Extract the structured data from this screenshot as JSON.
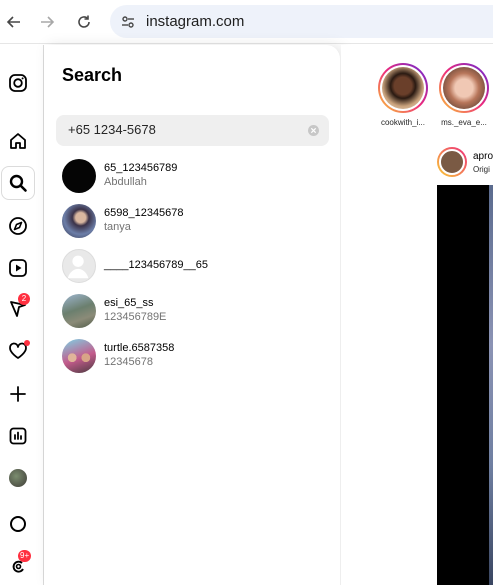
{
  "browser": {
    "url": "instagram.com",
    "back_icon": "arrow-left-icon",
    "forward_icon": "arrow-right-icon",
    "reload_icon": "reload-icon",
    "site_info_icon": "tune-icon"
  },
  "sidebar": {
    "items": [
      {
        "name": "instagram-logo-icon"
      },
      {
        "name": "home-icon"
      },
      {
        "name": "search-icon"
      },
      {
        "name": "explore-icon"
      },
      {
        "name": "reels-icon"
      },
      {
        "name": "messages-icon",
        "badge": "2"
      },
      {
        "name": "notifications-icon"
      },
      {
        "name": "create-icon"
      },
      {
        "name": "dashboard-icon"
      },
      {
        "name": "profile-avatar"
      },
      {
        "name": "threads-icon"
      },
      {
        "name": "more-icon",
        "badge": "9+"
      }
    ]
  },
  "search": {
    "title": "Search",
    "query": "+65 1234-5678",
    "results": [
      {
        "username": "65_123456789",
        "subtitle": "Abdullah"
      },
      {
        "username": "6598_12345678",
        "subtitle": "tanya"
      },
      {
        "username": "____123456789__65",
        "subtitle": ""
      },
      {
        "username": "esi_65_ss",
        "subtitle": "123456789E"
      },
      {
        "username": "turtle.6587358",
        "subtitle": "12345678"
      }
    ]
  },
  "feed": {
    "stories": [
      {
        "name": "cookwith_i..."
      },
      {
        "name": "ms._eva_e..."
      }
    ],
    "post": {
      "author": "apro",
      "subtitle": "Origi"
    }
  },
  "colors": {
    "badge": "#ff3040",
    "search_box": "#efefef",
    "muted_text": "#737373"
  }
}
